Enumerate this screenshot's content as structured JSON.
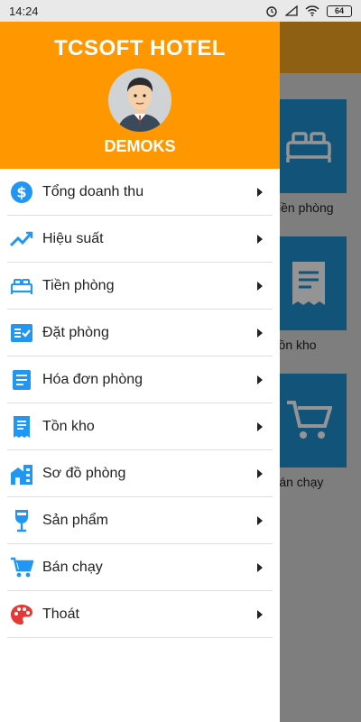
{
  "status_bar": {
    "time": "14:24",
    "battery": "64"
  },
  "header": {
    "title": "TCSOFT HOTEL",
    "username": "DEMOKS"
  },
  "menu": [
    {
      "label": "Tổng doanh thu",
      "icon": "dollar-icon"
    },
    {
      "label": "Hiệu suất",
      "icon": "trend-icon"
    },
    {
      "label": "Tiền phòng",
      "icon": "bed-icon"
    },
    {
      "label": "Đặt phòng",
      "icon": "checklist-icon"
    },
    {
      "label": "Hóa đơn phòng",
      "icon": "invoice-icon"
    },
    {
      "label": "Tồn kho",
      "icon": "receipt-icon"
    },
    {
      "label": "Sơ đồ phòng",
      "icon": "building-icon"
    },
    {
      "label": "Sản phẩm",
      "icon": "wineglass-icon"
    },
    {
      "label": "Bán chạy",
      "icon": "cart-icon"
    },
    {
      "label": "Thoát",
      "icon": "palette-icon"
    }
  ],
  "background": {
    "tiles": [
      {
        "caption": "Tiền phòng"
      },
      {
        "caption": "Tồn kho"
      },
      {
        "caption": "Bán chạy"
      }
    ]
  },
  "colors": {
    "primary": "#ff9800",
    "tile": "#1e8fd1",
    "icon": "#2196f3"
  }
}
